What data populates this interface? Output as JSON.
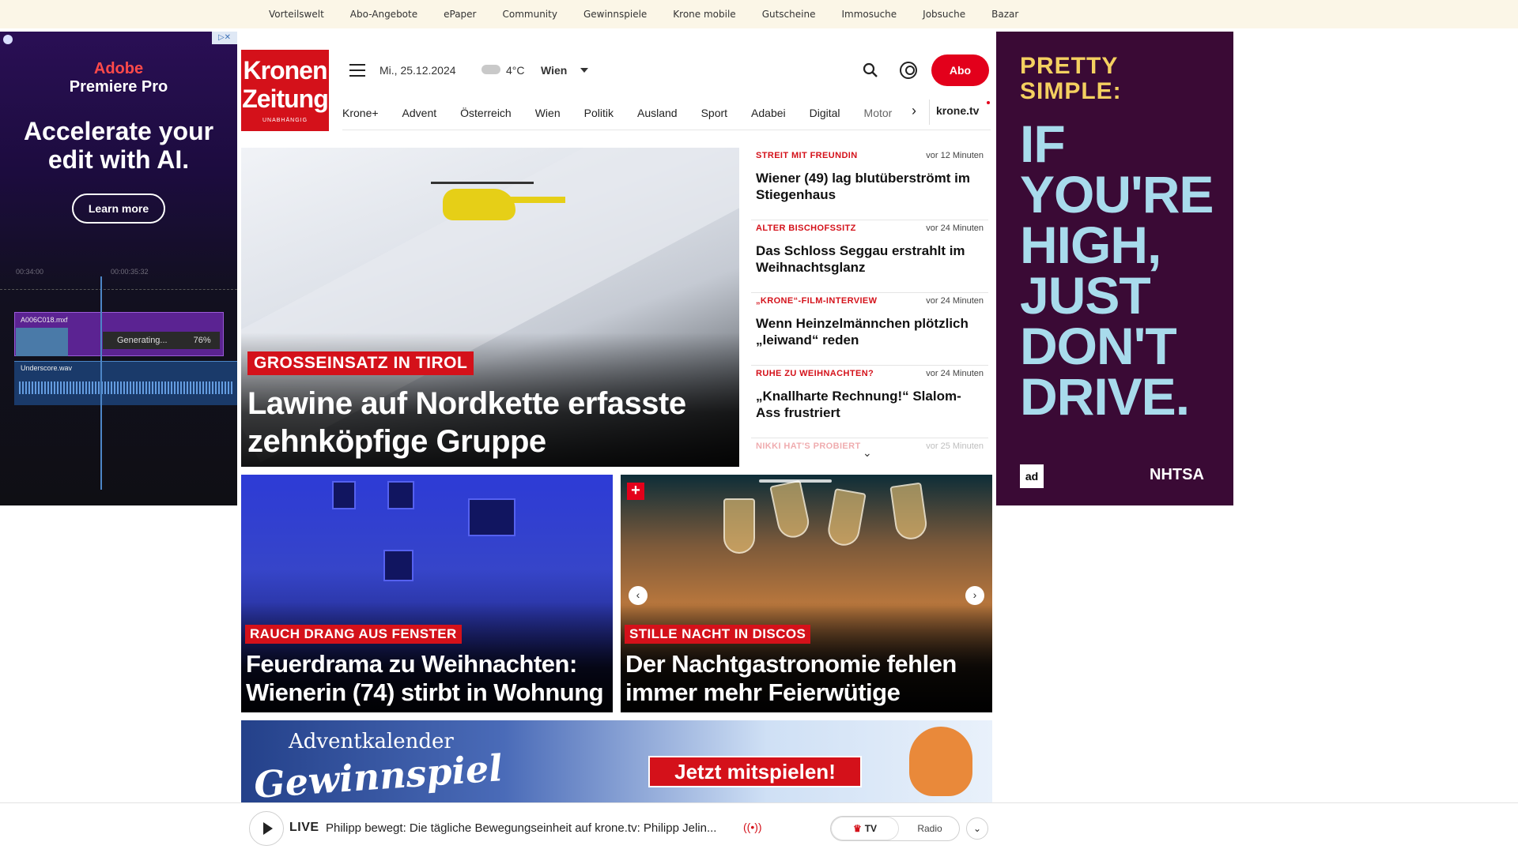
{
  "top_links": [
    "Vorteilswelt",
    "Abo-Angebote",
    "ePaper",
    "Community",
    "Gewinnspiele",
    "Krone mobile",
    "Gutscheine",
    "Immosuche",
    "Jobsuche",
    "Bazar"
  ],
  "ad_left": {
    "brand": "Adobe",
    "product": "Premiere Pro",
    "headline": "Accelerate your edit with AI.",
    "button": "Learn more",
    "clip_name": "A006C018.mxf",
    "generating": "Generating...",
    "progress": "76%",
    "audio_name": "Underscore.wav",
    "time_a": "00:34:00",
    "time_b": "00:00:35:32"
  },
  "ad_right": {
    "top": "PRETTY SIMPLE:",
    "main": "IF YOU'RE HIGH, JUST DON'T DRIVE.",
    "logo1": "ad",
    "logo2": "NHTSA"
  },
  "header": {
    "logo_line1": "Kronen",
    "logo_line2": "Zeitung",
    "logo_sub": "UNABHÄNGIG",
    "date": "Mi., 25.12.2024",
    "temperature": "4°C",
    "city": "Wien",
    "abo_button": "Abo"
  },
  "nav": {
    "items": [
      "Krone+",
      "Advent",
      "Österreich",
      "Wien",
      "Politik",
      "Ausland",
      "Sport",
      "Adabei",
      "Digital"
    ],
    "partial": "Motor",
    "tv": "krone.tv"
  },
  "hero": {
    "kicker": "GROSSEINSATZ IN TIROL",
    "title": "Lawine auf Nordkette erfasste zehnköpfige Gruppe"
  },
  "ticker": [
    {
      "kicker": "STREIT MIT FREUNDIN",
      "time": "vor 12 Minuten",
      "title": "Wiener (49) lag blutüberströmt im Stiegenhaus"
    },
    {
      "kicker": "ALTER BISCHOFSSITZ",
      "time": "vor 24 Minuten",
      "title": "Das Schloss Seggau erstrahlt im Weihnachtsglanz"
    },
    {
      "kicker": "„KRONE“-FILM-INTERVIEW",
      "time": "vor 24 Minuten",
      "title": "Wenn Heinzelmännchen plötzlich „leiwand“ reden"
    },
    {
      "kicker": "RUHE ZU WEIHNACHTEN?",
      "time": "vor 24 Minuten",
      "title": "„Knallharte Rechnung!“ Slalom-Ass frustriert"
    },
    {
      "kicker": "NIKKI HAT'S PROBIERT",
      "time": "vor 25 Minuten",
      "title": ""
    }
  ],
  "cards": [
    {
      "kicker": "RAUCH DRANG AUS FENSTER",
      "title": "Feuerdrama zu Weihnachten: Wienerin (74) stirbt in Wohnung"
    },
    {
      "kicker": "STILLE NACHT IN DISCOS",
      "title": "Der Nachtgastronomie fehlen immer mehr Feierwütige"
    }
  ],
  "banner": {
    "line1": "Adventkalender",
    "line2": "Gewinnspiel",
    "cta": "Jetzt mitspielen!"
  },
  "player": {
    "live": "LIVE",
    "text": "Philipp bewegt: Die tägliche Bewegungseinheit auf krone.tv: Philipp Jelin...",
    "tv": "TV",
    "radio": "Radio"
  },
  "colors": {
    "brand_red": "#d4111a",
    "topbar_bg": "#fbf6e7"
  }
}
